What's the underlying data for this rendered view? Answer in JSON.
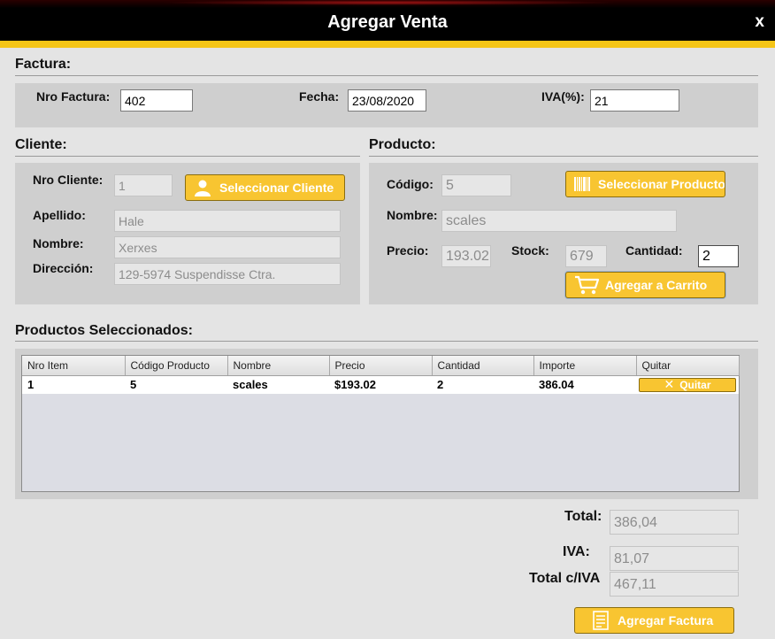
{
  "window": {
    "title": "Agregar Venta",
    "close_label": "x"
  },
  "factura": {
    "section_title": "Factura:",
    "nro_label": "Nro Factura:",
    "nro_value": "402",
    "fecha_label": "Fecha:",
    "fecha_value": "23/08/2020",
    "iva_label": "IVA(%):",
    "iva_value": "21"
  },
  "cliente": {
    "section_title": "Cliente:",
    "nro_label": "Nro Cliente:",
    "nro_value": "1",
    "select_button": "Seleccionar Cliente",
    "apellido_label": "Apellido:",
    "apellido_value": "Hale",
    "nombre_label": "Nombre:",
    "nombre_value": "Xerxes",
    "direccion_label": "Dirección:",
    "direccion_value": "129-5974 Suspendisse Ctra."
  },
  "producto": {
    "section_title": "Producto:",
    "codigo_label": "Código:",
    "codigo_value": "5",
    "select_button": "Seleccionar Producto",
    "nombre_label": "Nombre:",
    "nombre_value": "scales",
    "precio_label": "Precio:",
    "precio_value": "193.02",
    "stock_label": "Stock:",
    "stock_value": "679",
    "cantidad_label": "Cantidad:",
    "cantidad_value": "2",
    "add_button": "Agregar a Carrito"
  },
  "seleccionados": {
    "section_title": "Productos Seleccionados:",
    "columns": [
      "Nro Item",
      "Código Producto",
      "Nombre",
      "Precio",
      "Cantidad",
      "Importe",
      "Quitar"
    ],
    "rows": [
      {
        "item": "1",
        "codigo": "5",
        "nombre": "scales",
        "precio": "$193.02",
        "cantidad": "2",
        "importe": "386.04",
        "quitar": "Quitar"
      }
    ]
  },
  "totales": {
    "total_label": "Total:",
    "total_value": "386,04",
    "iva_label": "IVA:",
    "iva_value": "81,07",
    "total_iva_label": "Total c/IVA",
    "total_iva_value": "467,11",
    "submit_button": "Agregar Factura"
  },
  "colors": {
    "accent": "#f5c518",
    "button": "#f8c531",
    "titlebar": "#000000",
    "panel": "#cfcfcf"
  }
}
